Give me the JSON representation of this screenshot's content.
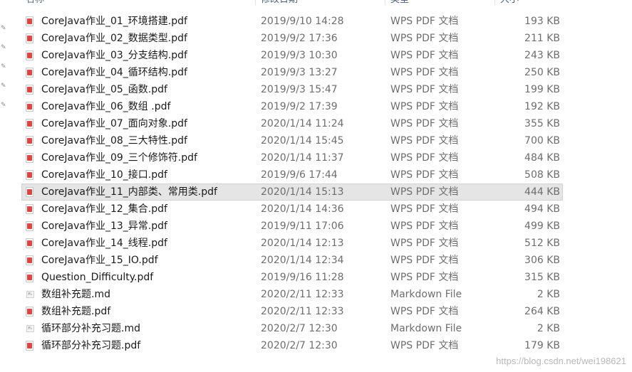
{
  "header": {
    "name": "名称",
    "date": "修改日期",
    "type": "类型",
    "size": "大小"
  },
  "files": [
    {
      "name": "CoreJava作业_01_环境搭建.pdf",
      "date": "2019/9/10 14:28",
      "type": "WPS PDF 文档",
      "size": "193 KB",
      "icon": "pdf-file-icon",
      "selected": false
    },
    {
      "name": "CoreJava作业_02_数据类型.pdf",
      "date": "2019/9/2 17:36",
      "type": "WPS PDF 文档",
      "size": "211 KB",
      "icon": "pdf-file-icon",
      "selected": false
    },
    {
      "name": "CoreJava作业_03_分支结构.pdf",
      "date": "2019/9/3 10:30",
      "type": "WPS PDF 文档",
      "size": "243 KB",
      "icon": "pdf-file-icon",
      "selected": false
    },
    {
      "name": "CoreJava作业_04_循环结构.pdf",
      "date": "2019/9/3 13:27",
      "type": "WPS PDF 文档",
      "size": "250 KB",
      "icon": "pdf-file-icon",
      "selected": false
    },
    {
      "name": "CoreJava作业_05_函数.pdf",
      "date": "2019/9/3 15:47",
      "type": "WPS PDF 文档",
      "size": "199 KB",
      "icon": "pdf-file-icon",
      "selected": false
    },
    {
      "name": "CoreJava作业_06_数组 .pdf",
      "date": "2019/9/2 17:39",
      "type": "WPS PDF 文档",
      "size": "192 KB",
      "icon": "pdf-file-icon",
      "selected": false
    },
    {
      "name": "CoreJava作业_07_面向对象.pdf",
      "date": "2020/1/14 11:24",
      "type": "WPS PDF 文档",
      "size": "355 KB",
      "icon": "pdf-file-icon",
      "selected": false
    },
    {
      "name": "CoreJava作业_08_三大特性.pdf",
      "date": "2020/1/14 15:45",
      "type": "WPS PDF 文档",
      "size": "700 KB",
      "icon": "pdf-file-icon",
      "selected": false
    },
    {
      "name": "CoreJava作业_09_三个修饰符.pdf",
      "date": "2020/1/14 11:37",
      "type": "WPS PDF 文档",
      "size": "484 KB",
      "icon": "pdf-file-icon",
      "selected": false
    },
    {
      "name": "CoreJava作业_10_接口.pdf",
      "date": "2019/9/6 17:44",
      "type": "WPS PDF 文档",
      "size": "508 KB",
      "icon": "pdf-file-icon",
      "selected": false
    },
    {
      "name": "CoreJava作业_11_内部类、常用类.pdf",
      "date": "2020/1/14 15:13",
      "type": "WPS PDF 文档",
      "size": "444 KB",
      "icon": "pdf-file-icon",
      "selected": true
    },
    {
      "name": "CoreJava作业_12_集合.pdf",
      "date": "2020/1/14 14:36",
      "type": "WPS PDF 文档",
      "size": "494 KB",
      "icon": "pdf-file-icon",
      "selected": false
    },
    {
      "name": "CoreJava作业_13_异常.pdf",
      "date": "2019/9/11 17:06",
      "type": "WPS PDF 文档",
      "size": "499 KB",
      "icon": "pdf-file-icon",
      "selected": false
    },
    {
      "name": "CoreJava作业_14_线程.pdf",
      "date": "2020/1/14 12:13",
      "type": "WPS PDF 文档",
      "size": "512 KB",
      "icon": "pdf-file-icon",
      "selected": false
    },
    {
      "name": "CoreJava作业_15_IO.pdf",
      "date": "2020/1/14 12:34",
      "type": "WPS PDF 文档",
      "size": "306 KB",
      "icon": "pdf-file-icon",
      "selected": false
    },
    {
      "name": "Question_Difficulty.pdf",
      "date": "2019/9/16 11:28",
      "type": "WPS PDF 文档",
      "size": "315 KB",
      "icon": "pdf-file-icon",
      "selected": false
    },
    {
      "name": "数组补充题.md",
      "date": "2020/2/11 12:33",
      "type": "Markdown File",
      "size": "2 KB",
      "icon": "markdown-file-icon",
      "selected": false
    },
    {
      "name": "数组补充题.pdf",
      "date": "2020/2/11 12:33",
      "type": "WPS PDF 文档",
      "size": "264 KB",
      "icon": "pdf-file-icon",
      "selected": false
    },
    {
      "name": "循环部分补充习题.md",
      "date": "2020/2/7 12:30",
      "type": "Markdown File",
      "size": "2 KB",
      "icon": "markdown-file-icon",
      "selected": false
    },
    {
      "name": "循环部分补充习题.pdf",
      "date": "2020/2/7 12:30",
      "type": "WPS PDF 文档",
      "size": "179 KB",
      "icon": "pdf-file-icon",
      "selected": false
    }
  ],
  "nav_pins": [
    "pin-icon",
    "pin-icon",
    "pin-icon",
    "pin-icon",
    "pin-icon"
  ],
  "watermark": "https://blog.csdn.net/wei198621"
}
